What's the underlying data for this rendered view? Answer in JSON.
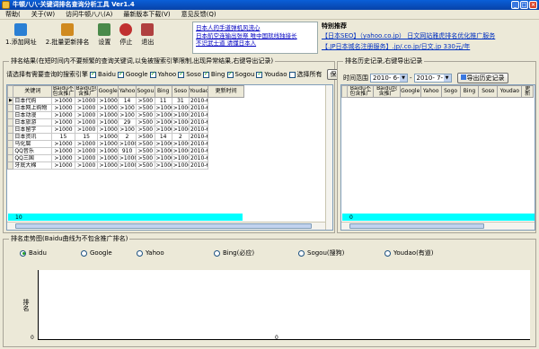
{
  "window": {
    "title": "牛顿八八·关键词排名查询分析工具 Ver1.4"
  },
  "menu": [
    "帮助(",
    "关于(W)",
    "访问牛顿八八(A)",
    "最新版本下载(V)",
    "意见反馈(Q)"
  ],
  "toolbar": [
    {
      "label": "1.添加网址",
      "icon": "add-url-icon",
      "color": "#2a7fd4"
    },
    {
      "label": "2.批量更新排名",
      "icon": "batch-update-icon",
      "color": "#d08a20"
    },
    {
      "label": "设置",
      "icon": "settings-icon",
      "color": "#4a8a4a"
    },
    {
      "label": "停止",
      "icon": "stop-icon",
      "color": "#c03030"
    },
    {
      "label": "退出",
      "icon": "exit-icon",
      "color": "#b04040"
    }
  ],
  "ads": [
    "日本人的手道弹机风流心",
    "日本航空连输出张祭 唯中国就线独接长",
    "不识武士道 请懂日本人"
  ],
  "recommend": {
    "title": "特别推荐",
    "links": [
      "【日本SEO】（yahoo.co.jp） 日文网站雅虎排名优化推广服务",
      "【.JP日本城名注册服务】.jp/.co.jp/日文.jp 330元/年"
    ]
  },
  "left": {
    "title": "排名结果(在短时间内不要频繁的查询关键词,以免被搜索引擎限制,出现异常结果,右键导出记录)",
    "engine_prompt": "请选择有需要查询的搜索引擎",
    "engines": [
      {
        "name": "Baidu",
        "checked": true
      },
      {
        "name": "Google",
        "checked": true
      },
      {
        "name": "Yahoo",
        "checked": true
      },
      {
        "name": "Soso",
        "checked": true
      },
      {
        "name": "Bing",
        "checked": true
      },
      {
        "name": "Sogou",
        "checked": true
      },
      {
        "name": "Youdao",
        "checked": true
      }
    ],
    "select_all": "选择所有",
    "save_button": "保存选择",
    "columns": [
      "关键词",
      "Baidu不包含推广",
      "Baidu包含推广",
      "Google",
      "Yahoo",
      "Sogou",
      "Bing",
      "Soso",
      "Youdao",
      "更新时间"
    ],
    "rows": [
      [
        "日本代购",
        ">1000",
        ">1000",
        ">1000",
        "14",
        ">500",
        "11",
        "31",
        "2010-6-9"
      ],
      [
        "日本网上购物",
        ">1000",
        ">1000",
        ">1000",
        ">100",
        ">500",
        ">1000",
        ">1000",
        "2010-6-9"
      ],
      [
        "日本动漫",
        ">1000",
        ">1000",
        ">1000",
        ">100",
        ">500",
        ">1000",
        ">1000",
        "2010-6-9"
      ],
      [
        "日本旅游",
        ">1000",
        ">1000",
        ">1000",
        "29",
        ">500",
        ">1000",
        ">1000",
        "2010-6-9"
      ],
      [
        "日本留学",
        ">1000",
        ">1000",
        ">1000",
        ">100",
        ">500",
        ">1000",
        ">1000",
        "2010-6-9"
      ],
      [
        "日本资讯",
        "15",
        "15",
        ">1000",
        "2",
        ">500",
        "14",
        "2",
        "2010-6-9"
      ],
      [
        "乌化腐",
        ">1000",
        ">1000",
        ">1000",
        ">1000",
        ">500",
        ">1000",
        ">1000",
        "2010-6-9"
      ],
      [
        "QQ音乐",
        ">1000",
        ">1000",
        ">1000",
        "910",
        ">500",
        ">1000",
        ">1000",
        "2010-6-9"
      ],
      [
        "QQ三国",
        ">1000",
        ">1000",
        ">1000",
        ">1000",
        ">500",
        ">1000",
        ">1000",
        "2010-6-9"
      ],
      [
        "牙底大棉",
        ">1000",
        ">1000",
        ">1000",
        ">1000",
        ">500",
        ">1000",
        ">1000",
        "2010-6-9"
      ]
    ],
    "footer_value": "10"
  },
  "right": {
    "title": "排名历史记录,右键导出记录",
    "range_label": "时间范围",
    "from_date": "2010- 6- 9",
    "to_date": "2010- 7- 9",
    "export_button": "导出历史记录",
    "columns": [
      "Baidu不包含推广",
      "Baidu包含推广",
      "Google",
      "Yahoo",
      "Sogo",
      "Bing",
      "Soso",
      "Youdao",
      "更新"
    ],
    "footer_value": "0"
  },
  "bottom": {
    "title": "排名走势图(Baidu曲线为不包含推广排名)",
    "engines": [
      {
        "name": "Baidu",
        "selected": true
      },
      {
        "name": "Google",
        "selected": false
      },
      {
        "name": "Yahoo",
        "selected": false
      },
      {
        "name": "Bing(必应)",
        "selected": false
      },
      {
        "name": "Sogou(搜狗)",
        "selected": false
      },
      {
        "name": "Youdao(有道)",
        "selected": false
      }
    ],
    "y_label": "排名",
    "x_zero": "0",
    "y_zero": "0"
  }
}
